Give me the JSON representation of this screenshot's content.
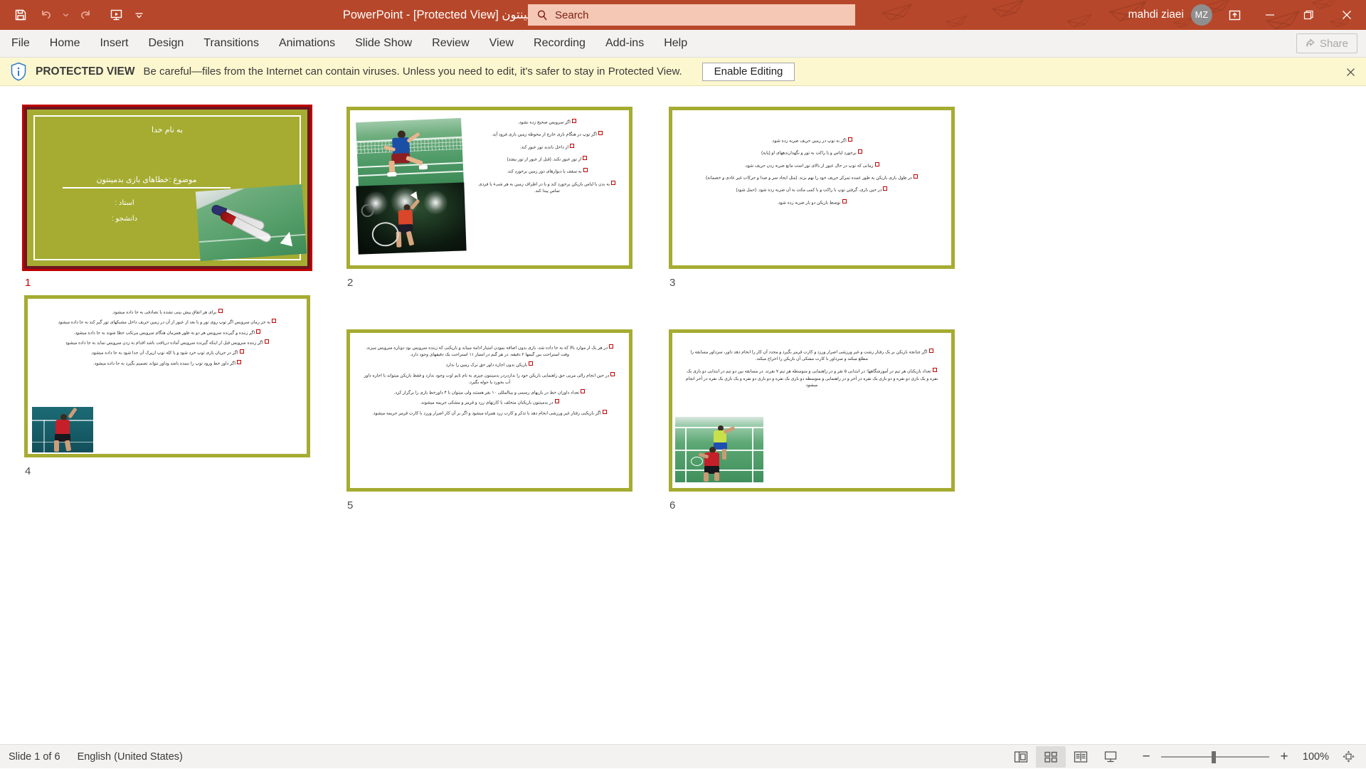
{
  "app": {
    "name": "PowerPoint",
    "document_title": "خطاهای بازی بدمینتون",
    "protected_tag": "[Protected View]",
    "separator": "-",
    "title_full": "خطاهای بازی بدمینتون [Protected View]  -  PowerPoint"
  },
  "quick_access": {
    "save": "save-icon",
    "undo": "undo-icon",
    "undo_more": "undo-dropdown-icon",
    "redo": "redo-icon",
    "present": "start-presentation-icon",
    "customize": "customize-qat-icon"
  },
  "search": {
    "placeholder": "Search",
    "icon": "search-icon"
  },
  "account": {
    "user_name": "mahdi ziaei",
    "initials": "MZ"
  },
  "window_controls": {
    "ribbon_display": "ribbon-display-options-icon",
    "minimize": "minimize-icon",
    "restore": "restore-icon",
    "close": "close-icon"
  },
  "ribbon": {
    "tabs": [
      "File",
      "Home",
      "Insert",
      "Design",
      "Transitions",
      "Animations",
      "Slide Show",
      "Review",
      "View",
      "Recording",
      "Add-ins",
      "Help"
    ],
    "active_tab": "",
    "share_label": "Share"
  },
  "protected_view": {
    "icon": "shield-info-icon",
    "label": "PROTECTED VIEW",
    "message": "Be careful—files from the Internet can contain viruses. Unless you need to edit, it's safer to stay in Protected View.",
    "enable_button": "Enable Editing",
    "close_icon": "close-icon"
  },
  "slides": [
    {
      "number": "1",
      "selected": true,
      "type": "title",
      "lines": {
        "bismillah": "به نام خدا",
        "topic": "موضوع :خطاهای بازی بدمینتون",
        "teacher": "استاد :",
        "student": "دانشجو :"
      }
    },
    {
      "number": "2",
      "selected": false,
      "type": "content",
      "bullets": [
        "اگر سرویس صحیح زده نشود.",
        "اگر توپ در هنگام بازی خارج از محوطه زمین بازی فرود آید.",
        "از داخل بانديد تور عبور کند.",
        "از تور عبور نکند. (قبل از عبور از تور بیفتد)",
        "به سقف یا دیوارهای دور زمین برخورد کند.",
        "به بدن یا لباس بازیکن برخورد کند و یا در اطراف زمین به هر شیء یا فردی تماس پیدا کند."
      ]
    },
    {
      "number": "3",
      "selected": false,
      "type": "content",
      "bullets": [
        "اگر به توپ در زمین حریف ضربه زده شود.",
        "برخورد لباس و یا راکت به تور و نگهدارندههای او (پایه)",
        "زمانی که توپ در حال عبور از بالای تور است مانع ضربه زدن حریف شود.",
        "در طول بازی بازیکن به طور عمده تمرکز حریف خود را بهم بزند. (مثل ایجاد سر و صدا و حرکات غیر عادی و خصمانه)",
        "در حین بازی، گرفتن توپ با راکت و با کمی مکث به آن ضربه زده شود. (حمل شود)",
        "توسط بازیکن دو بار ضربه زده شود."
      ]
    },
    {
      "number": "4",
      "selected": false,
      "type": "content",
      "bullets": [
        "برای هر اتفاق پیش بینی نشده یا تصادفی به جا داده میشود.",
        "به جز زمان سرویس اگر توپ روی تور و یا بعد از عبور از آن در زمین حریف داخل مشبکهای تور گیر کند به جا داده میشود",
        "اگر زننده و گیرنده سرویس هر دو به طور همزمان هنگام سرویس مرتکب خطا شوند به جا داده میشود.",
        "اگر زننده سرویس قبل از اینکه گیرنده سرویس آماده دریافت باشد اقدام به زدن سرویس نماید به جا داده میشود",
        "اگر در جریان بازی توپ خرد شود و یا کله توپ ازپرک آن جدا شود به جا داده میشود.",
        "اگر داور خط ورود توپ را ننمده باشد وداور نتواند تصمیم بگیرد به جا داده میشود."
      ]
    },
    {
      "number": "5",
      "selected": false,
      "type": "content",
      "bullets": [
        "در هر یک از موارد بالا که به جا داده شد، بازی بدون اضافه نمودن امتیاز ادامه مییابد و بازیکنی که زننده سرویس بود دوباره سرویس میزند. وقت استراحت بین گیمها ۲ دقیقه. در هر گیم در امتیاز ۱۱ استراحت یک دقیقهای وجود دارد.",
        "بازیکن بدون اجازه داور حق ترک زمین را ندارد",
        "در حین انجام رالی مربی حق راهنمایی بازیکن خود را نداردردر بدمینتون چیزی به نام تایم اوت وجود ندارد و فقط بازیکن میتواند با اجازه داور آب بخورد یا حوله بگیرد.",
        "تعداد داوران خط در بازیهای رسمی و بینالمللی ۱۰ نفر هستند ولی میتوان با ۴ داورخط بازی را برگزار کرد.",
        "در بدمینتون بازیکنان متخلف با کارتهای زرد و قرمز و مشکی جریمه میشوند.",
        "اگر بازیکنی رفتار غیر ورزشی انجام دهد با تذکر و کارت زرد همراه میشود و اگر بر آن کار اصرار ورزد با کارت قرمز جریمه میشود."
      ]
    },
    {
      "number": "6",
      "selected": false,
      "type": "content",
      "bullets": [
        "اگر چنانچه بازیکن بر یک رفتار زشت و غیر ورزشی اصرار ورزد و کارت قرمز بگیرد و مجدد آن کار را انجام دهد داور، سرداور مسابقه را مطلع میکند و سرداور با کارت مشکی آن بازیکن را اخراج میکند.",
        "تعداد بازیکنان هر تیم در آموزشگاهها: در ابتدایی ۵ نفر و در راهنمایی و متوسطه هر تیم ۷ نفرند. در مسابقه بین دو تیم در ابتدایی دو بازی یک نفره و یک بازی دو نفره و دو بازی یک نفره در آخر و در راهنمایی و متوسطه دو بازی یک نفره و دو بازی دو نفره و یک بازی یک نفره در آخر انجام میشود"
      ]
    }
  ],
  "status_bar": {
    "slide_counter": "Slide 1 of 6",
    "language": "English (United States)",
    "views": [
      {
        "name": "normal-view",
        "label": "Normal",
        "active": false
      },
      {
        "name": "slide-sorter-view",
        "label": "Slide Sorter",
        "active": true
      },
      {
        "name": "reading-view",
        "label": "Reading View",
        "active": false
      },
      {
        "name": "slide-show-view",
        "label": "Slide Show",
        "active": false
      }
    ],
    "zoom_out": "−",
    "zoom_in": "+",
    "zoom_level": "100%",
    "fit_to_window": "fit-to-window-icon"
  },
  "colors": {
    "accent": "#b7472a",
    "slide_green": "#a5ac31",
    "selection": "#c00000",
    "protected_bar": "#fdf7cf"
  }
}
